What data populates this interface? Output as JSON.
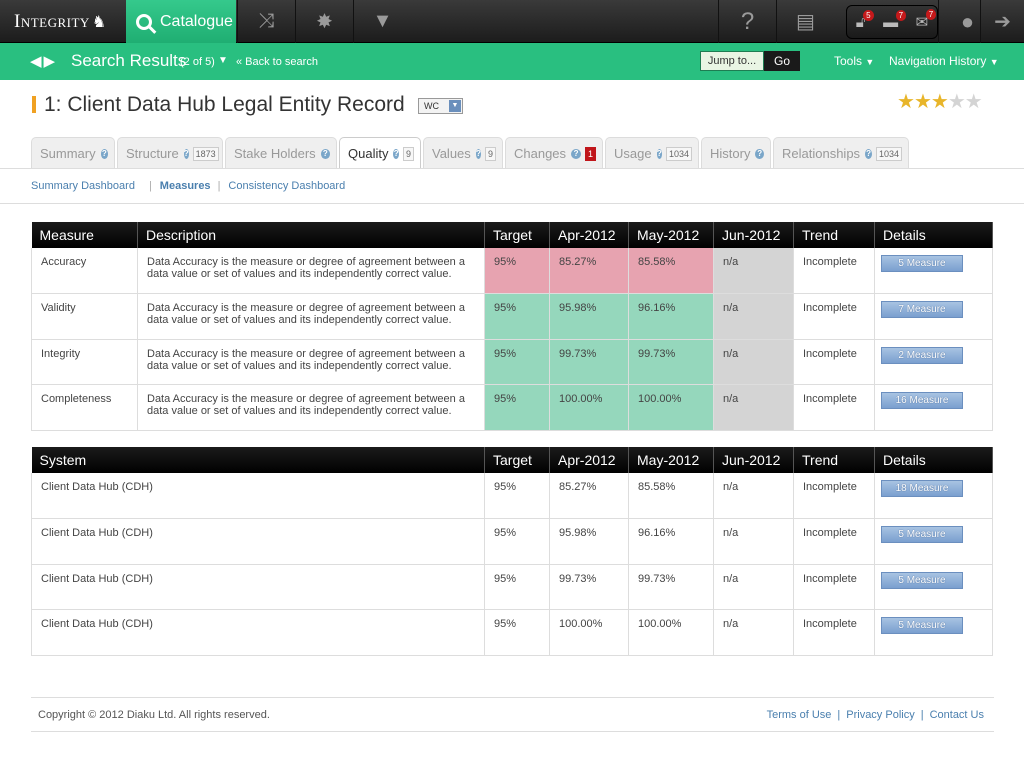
{
  "topbar": {
    "logo_text": "Integrity",
    "catalogue_label": "Catalogue",
    "icons": [
      "shuffle-icon",
      "burst-icon",
      "triangle-down-icon",
      "help-icon",
      "id-card-icon",
      "user-icon",
      "logout-icon"
    ],
    "notifications": [
      {
        "icon": "lock-icon",
        "count": "5"
      },
      {
        "icon": "chat-icon",
        "count": "7"
      },
      {
        "icon": "mail-icon",
        "count": "7"
      }
    ]
  },
  "greenbar": {
    "title": "Search Results",
    "count": "(2 of 5)",
    "back": "« Back to search",
    "jump_label": "Jump to...",
    "go_label": "Go",
    "tools": "Tools",
    "nav_history": "Navigation History"
  },
  "record": {
    "title": "1: Client Data Hub Legal Entity Record",
    "badge": "WC",
    "rating": 3,
    "rating_max": 5
  },
  "tabs": [
    {
      "label": "Summary",
      "count": ""
    },
    {
      "label": "Structure",
      "count": "1873"
    },
    {
      "label": "Stake Holders",
      "count": ""
    },
    {
      "label": "Quality",
      "count": "9"
    },
    {
      "label": "Values",
      "count": "9"
    },
    {
      "label": "Changes",
      "count": "1"
    },
    {
      "label": "Usage",
      "count": "1034"
    },
    {
      "label": "History",
      "count": ""
    },
    {
      "label": "Relationships",
      "count": "1034"
    }
  ],
  "subnav": {
    "summary": "Summary Dashboard",
    "measures": "Measures",
    "consistency": "Consistency Dashboard"
  },
  "measures_table": {
    "headers": [
      "Measure",
      "Description",
      "Target",
      "Apr-2012",
      "May-2012",
      "Jun-2012",
      "Trend",
      "Details"
    ],
    "rows": [
      {
        "measure": "Accuracy",
        "desc1": "Data Accuracy is the measure or degree of agreement between a",
        "desc2": "data value or set of values and its independently correct value.",
        "target": "95%",
        "apr": "85.27%",
        "may": "85.58%",
        "jun": "n/a",
        "trend": "Incomplete",
        "details": "5 Measure"
      },
      {
        "measure": "Validity",
        "desc1": "Data Accuracy is the measure or degree of agreement between a",
        "desc2": "data value or set of values and its independently correct value.",
        "target": "95%",
        "apr": "95.98%",
        "may": "96.16%",
        "jun": "n/a",
        "trend": "Incomplete",
        "details": "7 Measure"
      },
      {
        "measure": "Integrity",
        "desc1": "Data Accuracy is the measure or degree of agreement between a",
        "desc2": "data value or set of values and its independently correct value.",
        "target": "95%",
        "apr": "99.73%",
        "may": "99.73%",
        "jun": "n/a",
        "trend": "Incomplete",
        "details": "2 Measure"
      },
      {
        "measure": "Completeness",
        "desc1": "Data Accuracy is the measure or degree of agreement between a",
        "desc2": "data value or set of values and its independently correct value.",
        "target": "95%",
        "apr": "100.00%",
        "may": "100.00%",
        "jun": "n/a",
        "trend": "Incomplete",
        "details": "16 Measure"
      }
    ]
  },
  "system_table": {
    "headers": [
      "System",
      "Target",
      "Apr-2012",
      "May-2012",
      "Jun-2012",
      "Trend",
      "Details"
    ],
    "rows": [
      {
        "system": "Client Data Hub (CDH)",
        "target": "95%",
        "apr": "85.27%",
        "may": "85.58%",
        "jun": "n/a",
        "trend": "Incomplete",
        "details": "18 Measure"
      },
      {
        "system": "Client Data Hub (CDH)",
        "target": "95%",
        "apr": "95.98%",
        "may": "96.16%",
        "jun": "n/a",
        "trend": "Incomplete",
        "details": "5 Measure"
      },
      {
        "system": "Client Data Hub (CDH)",
        "target": "95%",
        "apr": "99.73%",
        "may": "99.73%",
        "jun": "n/a",
        "trend": "Incomplete",
        "details": "5 Measure"
      },
      {
        "system": "Client Data Hub (CDH)",
        "target": "95%",
        "apr": "100.00%",
        "may": "100.00%",
        "jun": "n/a",
        "trend": "Incomplete",
        "details": "5 Measure"
      }
    ]
  },
  "footer": {
    "copyright": "Copyright © 2012 Diaku Ltd. All rights reserved.",
    "terms": "Terms of Use",
    "privacy": "Privacy Policy",
    "contact": "Contact Us"
  },
  "colors": {
    "brand_green": "#29bf80",
    "below_target": "#e7a3b0",
    "above_target": "#95d7bc",
    "no_data": "#d4d4d4"
  }
}
